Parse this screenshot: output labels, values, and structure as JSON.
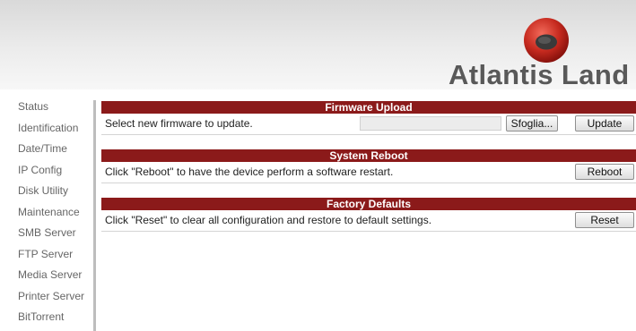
{
  "brand": {
    "name": "Atlantis Land",
    "accent_color": "#c0392b",
    "header_bar_color": "#8b1a1a"
  },
  "sidebar": {
    "items": [
      {
        "label": "Status"
      },
      {
        "label": "Identification"
      },
      {
        "label": "Date/Time"
      },
      {
        "label": "IP Config"
      },
      {
        "label": "Disk Utility"
      },
      {
        "label": "Maintenance"
      },
      {
        "label": "SMB Server"
      },
      {
        "label": "FTP Server"
      },
      {
        "label": "Media Server"
      },
      {
        "label": "Printer Server"
      },
      {
        "label": "BitTorrent"
      }
    ]
  },
  "sections": {
    "firmware": {
      "title": "Firmware Upload",
      "text": "Select new firmware to update.",
      "file_value": "",
      "browse_label": "Sfoglia...",
      "button_label": "Update"
    },
    "reboot": {
      "title": "System Reboot",
      "text": "Click \"Reboot\" to have the device perform a software restart.",
      "button_label": "Reboot"
    },
    "defaults": {
      "title": "Factory Defaults",
      "text": "Click \"Reset\" to clear all configuration and restore to default settings.",
      "button_label": "Reset"
    }
  }
}
